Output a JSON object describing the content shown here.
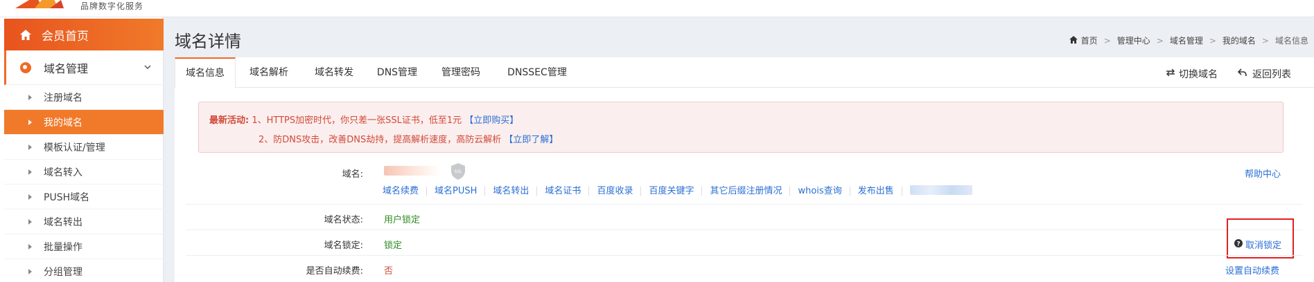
{
  "brand": {
    "subtitle": "品牌数字化服务"
  },
  "sidebar": {
    "home": {
      "label": "会员首页",
      "icon": "home-icon"
    },
    "group": {
      "label": "域名管理",
      "icon": "domain-icon"
    },
    "items": [
      {
        "label": "注册域名",
        "active": false
      },
      {
        "label": "我的域名",
        "active": true
      },
      {
        "label": "模板认证/管理",
        "active": false
      },
      {
        "label": "域名转入",
        "active": false
      },
      {
        "label": "PUSH域名",
        "active": false
      },
      {
        "label": "域名转出",
        "active": false
      },
      {
        "label": "批量操作",
        "active": false
      },
      {
        "label": "分组管理",
        "active": false
      }
    ]
  },
  "page": {
    "title": "域名详情"
  },
  "breadcrumb": [
    "首页",
    "管理中心",
    "域名管理",
    "我的域名",
    "域名信息"
  ],
  "tabs": [
    "域名信息",
    "域名解析",
    "域名转发",
    "DNS管理",
    "管理密码",
    "DNSSEC管理"
  ],
  "tools": {
    "switch": "切换域名",
    "back": "返回列表"
  },
  "notice": {
    "prefix": "最新活动:",
    "line1": "1、HTTPS加密时代，你只差一张SSL证书，低至1元",
    "line1_link": "【立即购买】",
    "line2": "2、防DNS攻击，改善DNS劫持，提高解析速度，高防云解析",
    "line2_link": "【立即了解】"
  },
  "domain": {
    "label": "域名:",
    "ssl_badge": "SSL",
    "help": "帮助中心",
    "links": [
      "域名续费",
      "域名PUSH",
      "域名转出",
      "域名证书",
      "百度收录",
      "百度关键字",
      "其它后缀注册情况",
      "whois查询",
      "发布出售"
    ]
  },
  "rows": {
    "status": {
      "label": "域名状态:",
      "value": "用户锁定"
    },
    "lock": {
      "label": "域名锁定:",
      "value": "锁定",
      "action": "取消锁定"
    },
    "auto_renew": {
      "label": "是否自动续费:",
      "value": "否",
      "action": "设置自动续费"
    }
  },
  "colors": {
    "accent": "#ef6a25",
    "link": "#2a6fd6",
    "ok": "#2e8b22",
    "danger": "#d14a3a"
  }
}
